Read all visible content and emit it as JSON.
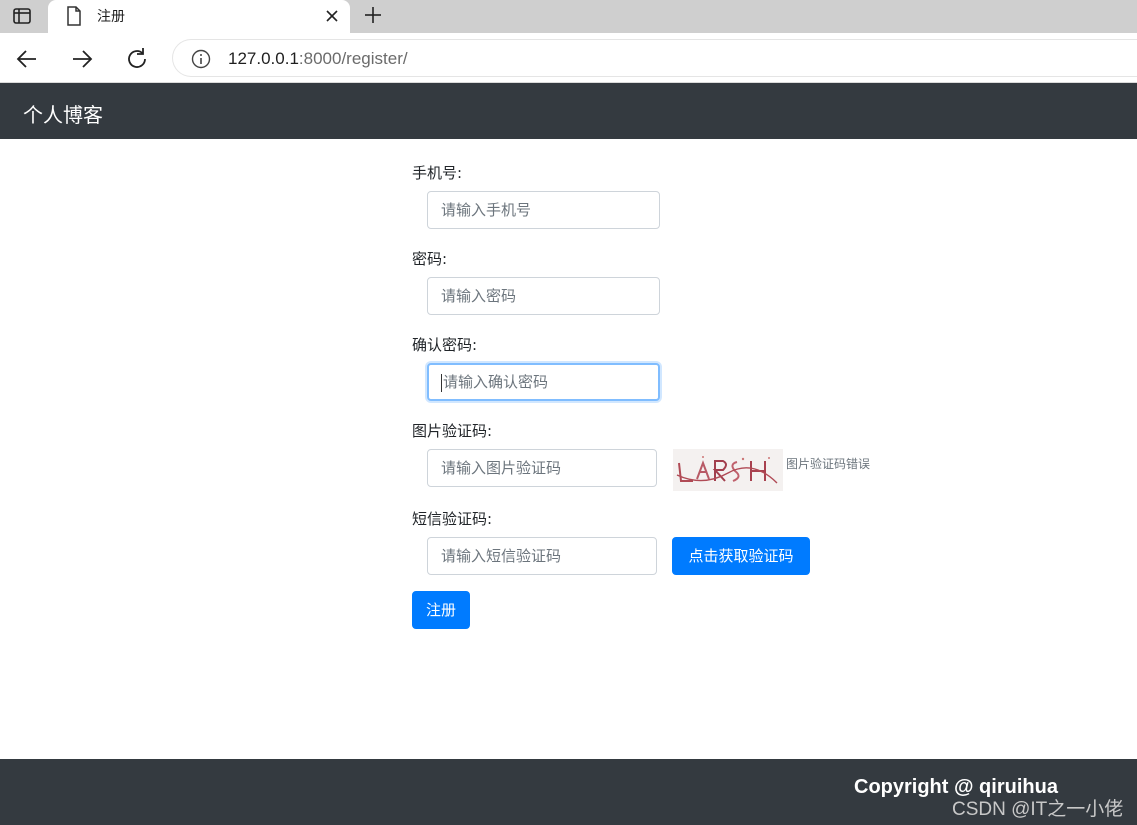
{
  "browser": {
    "tab_title": "注册",
    "url_host": "127.0.0.1",
    "url_path": ":8000/register/",
    "icons": [
      "sidebar-toggle-icon",
      "document-icon",
      "close-icon",
      "plus-icon",
      "back-arrow-icon",
      "forward-arrow-icon",
      "reload-icon",
      "info-icon"
    ]
  },
  "navbar": {
    "brand": "个人博客"
  },
  "form": {
    "phone": {
      "label": "手机号:",
      "placeholder": "请输入手机号"
    },
    "password": {
      "label": "密码:",
      "placeholder": "请输入密码"
    },
    "confirm_password": {
      "label": "确认密码:",
      "placeholder": "请输入确认密码"
    },
    "image_code": {
      "label": "图片验证码:",
      "placeholder": "请输入图片验证码",
      "error": "图片验证码错误"
    },
    "sms_code": {
      "label": "短信验证码:",
      "placeholder": "请输入短信验证码",
      "button": "点击获取验证码"
    },
    "submit_label": "注册"
  },
  "footer": {
    "copyright": "Copyright @ qiruihua",
    "watermark": "CSDN @IT之一小佬"
  },
  "colors": {
    "navbar": "#343a40",
    "primary": "#007bff",
    "focus_border": "#80bdff"
  }
}
